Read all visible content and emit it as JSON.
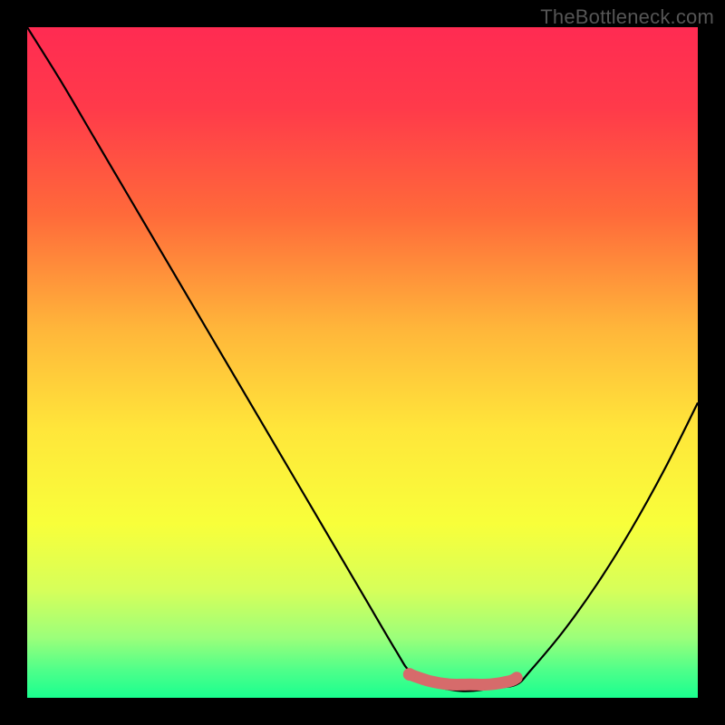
{
  "watermark": "TheBottleneck.com",
  "chart_data": {
    "type": "line",
    "title": "",
    "xlabel": "",
    "ylabel": "",
    "xlim": [
      0,
      100
    ],
    "ylim": [
      0,
      100
    ],
    "grid": false,
    "legend": false,
    "series": [
      {
        "name": "curve",
        "color": "#000000",
        "x": [
          0,
          5,
          10,
          15,
          20,
          25,
          30,
          35,
          40,
          45,
          50,
          55,
          57,
          60,
          65,
          70,
          73,
          75,
          80,
          85,
          90,
          95,
          100
        ],
        "y": [
          100,
          92,
          83.5,
          75,
          66.5,
          58,
          49.5,
          41,
          32.5,
          24,
          15.5,
          7,
          4,
          2,
          1,
          1.5,
          2,
          4,
          10,
          17,
          25,
          34,
          44
        ]
      },
      {
        "name": "optimal-band",
        "color": "#d66b6b",
        "x": [
          57,
          60,
          63,
          66,
          69,
          72,
          73
        ],
        "y": [
          3.5,
          2.5,
          2,
          2,
          2,
          2.5,
          3
        ]
      }
    ],
    "background_gradient": {
      "stops": [
        {
          "offset": 0.0,
          "color": "#ff2b52"
        },
        {
          "offset": 0.12,
          "color": "#ff3a4a"
        },
        {
          "offset": 0.28,
          "color": "#ff6a3a"
        },
        {
          "offset": 0.45,
          "color": "#ffb63a"
        },
        {
          "offset": 0.6,
          "color": "#ffe63a"
        },
        {
          "offset": 0.74,
          "color": "#f8ff3a"
        },
        {
          "offset": 0.84,
          "color": "#d6ff5a"
        },
        {
          "offset": 0.91,
          "color": "#9cff7a"
        },
        {
          "offset": 0.96,
          "color": "#4dff8a"
        },
        {
          "offset": 1.0,
          "color": "#1aff8f"
        }
      ]
    }
  }
}
